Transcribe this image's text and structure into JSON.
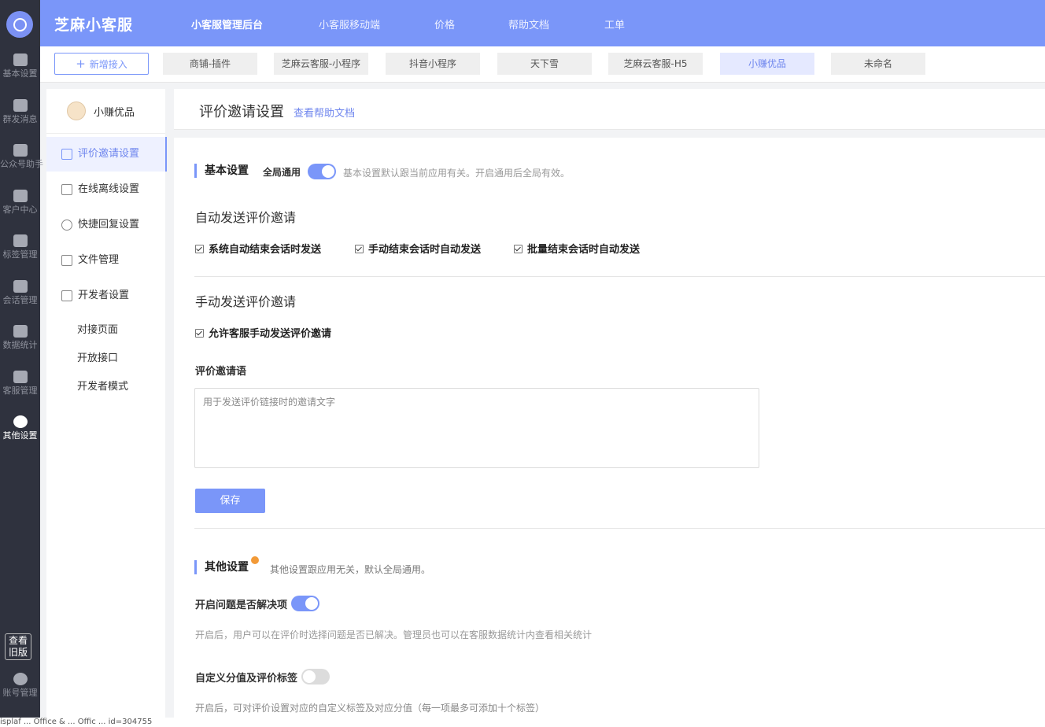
{
  "rail": {
    "items": [
      {
        "label": "基本设置",
        "icon": "grid-icon"
      },
      {
        "label": "群发消息",
        "icon": "paper-plane-icon"
      },
      {
        "label": "公众号助手",
        "icon": "wechat-icon"
      },
      {
        "label": "客户中心",
        "icon": "users-icon"
      },
      {
        "label": "标签管理",
        "icon": "tag-icon"
      },
      {
        "label": "会话管理",
        "icon": "chat-icon"
      },
      {
        "label": "数据统计",
        "icon": "bar-chart-icon"
      },
      {
        "label": "客服管理",
        "icon": "robot-icon"
      },
      {
        "label": "其他设置",
        "icon": "gear-icon"
      }
    ],
    "old_version": "查看旧版",
    "account": "账号管理"
  },
  "topbar": {
    "brand": "芝麻小客服",
    "nav": [
      "小客服管理后台",
      "小客服移动端",
      "价格",
      "帮助文档",
      "工单"
    ]
  },
  "tabs": {
    "add_label": "新增接入",
    "items": [
      "商铺-插件",
      "芝麻云客服-小程序",
      "抖音小程序",
      "天下雪",
      "芝麻云客服-H5",
      "小赚优品",
      "未命名"
    ]
  },
  "side": {
    "title": "小赚优品",
    "items": [
      "评价邀请设置",
      "在线离线设置",
      "快捷回复设置",
      "文件管理",
      "开发者设置"
    ],
    "sub_items": [
      "对接页面",
      "开放接口",
      "开发者模式"
    ]
  },
  "page": {
    "title": "评价邀请设置",
    "help_link": "查看帮助文档"
  },
  "basic": {
    "title": "基本设置",
    "global_label": "全局通用",
    "hint": "基本设置默认跟当前应用有关。开启通用后全局有效。",
    "auto_heading": "自动发送评价邀请",
    "auto_options": [
      "系统自动结束会话时发送",
      "手动结束会话时自动发送",
      "批量结束会话时自动发送"
    ],
    "manual_heading": "手动发送评价邀请",
    "manual_option": "允许客服手动发送评价邀请",
    "invite_label": "评价邀请语",
    "invite_placeholder": "用于发送评价链接时的邀请文字",
    "save": "保存"
  },
  "other": {
    "title": "其他设置",
    "hint": "其他设置跟应用无关，默认全局通用。",
    "q1_label": "开启问题是否解决项",
    "q1_hint": "开启后，用户可以在评价时选择问题是否已解决。管理员也可以在客服数据统计内查看相关统计",
    "q2_label": "自定义分值及评价标签",
    "q2_hint": "开启后，可对评价设置对应的自定义标签及对应分值（每一项最多可添加十个标签）"
  },
  "status_text": "isplaf ... Office & ... Offic ... id=304755"
}
